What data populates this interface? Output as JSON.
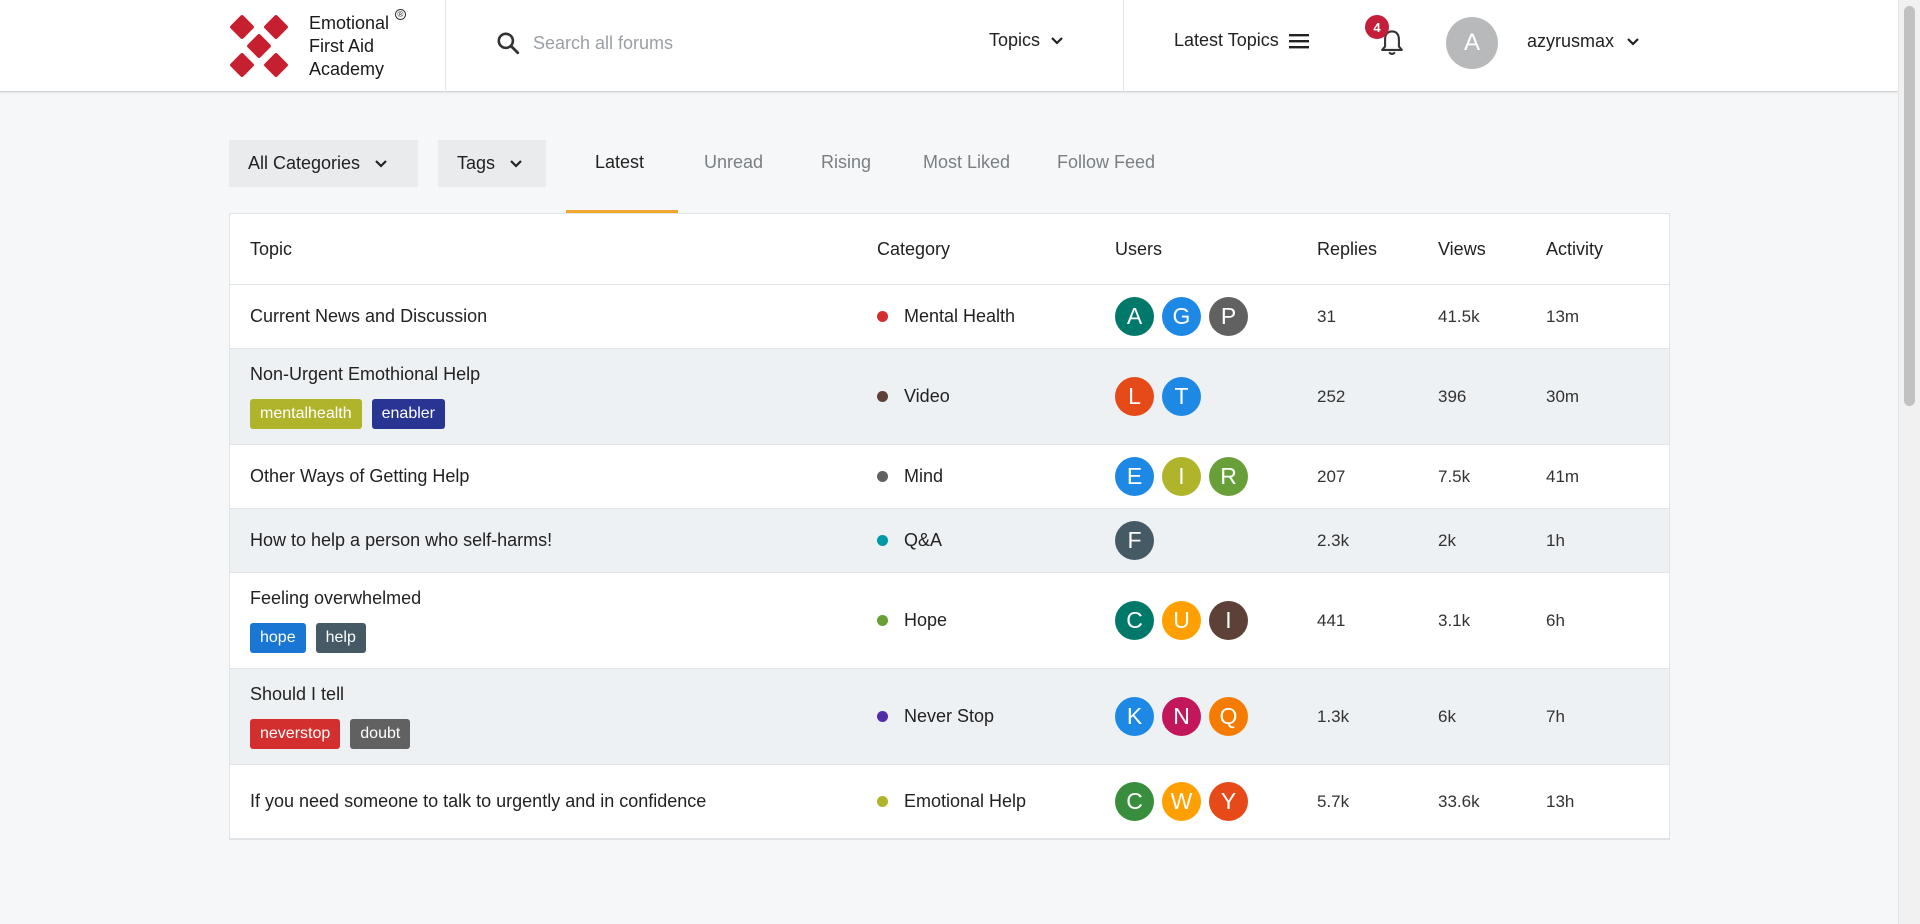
{
  "brand": {
    "line1": "Emotional",
    "line2": "First Aid",
    "line3": "Academy",
    "registered": "®"
  },
  "search": {
    "placeholder": "Search all forums"
  },
  "header_nav": {
    "topics": "Topics",
    "latest_topics": "Latest Topics"
  },
  "notifications": {
    "count": "4"
  },
  "user": {
    "avatar_letter": "A",
    "name": "azyrusmax"
  },
  "filters": {
    "categories": "All Categories",
    "tags": "Tags"
  },
  "tabs": [
    "Latest",
    "Unread",
    "Rising",
    "Most Liked",
    "Follow Feed"
  ],
  "columns": {
    "topic": "Topic",
    "category": "Category",
    "users": "Users",
    "replies": "Replies",
    "views": "Views",
    "activity": "Activity"
  },
  "topics": [
    {
      "title": "Current News and Discussion",
      "tags": [],
      "category": "Mental Health",
      "cat_color": "#d32f2f",
      "users": [
        {
          "l": "A",
          "c": "#00796b"
        },
        {
          "l": "G",
          "c": "#1e88e5"
        },
        {
          "l": "P",
          "c": "#616161"
        }
      ],
      "replies": "31",
      "views": "41.5k",
      "activity": "13m"
    },
    {
      "title": "Non-Urgent Emothional Help",
      "tags": [
        {
          "t": "mentalhealth",
          "c": "#afb42b"
        },
        {
          "t": "enabler",
          "c": "#283593"
        }
      ],
      "category": "Video",
      "cat_color": "#5d4037",
      "users": [
        {
          "l": "L",
          "c": "#e64a19"
        },
        {
          "l": "T",
          "c": "#1e88e5"
        }
      ],
      "replies": "252",
      "views": "396",
      "activity": "30m"
    },
    {
      "title": "Other Ways of Getting Help",
      "tags": [],
      "category": "Mind",
      "cat_color": "#616161",
      "users": [
        {
          "l": "E",
          "c": "#1e88e5"
        },
        {
          "l": "I",
          "c": "#afb42b"
        },
        {
          "l": "R",
          "c": "#689f38"
        }
      ],
      "replies": "207",
      "views": "7.5k",
      "activity": "41m"
    },
    {
      "title": "How to help a person who self-harms!",
      "tags": [],
      "category": "Q&A",
      "cat_color": "#0097a7",
      "users": [
        {
          "l": "F",
          "c": "#455a64"
        }
      ],
      "replies": "2.3k",
      "views": "2k",
      "activity": "1h"
    },
    {
      "title": "Feeling overwhelmed",
      "tags": [
        {
          "t": "hope",
          "c": "#1976d2"
        },
        {
          "t": "help",
          "c": "#455a64"
        }
      ],
      "category": "Hope",
      "cat_color": "#689f38",
      "users": [
        {
          "l": "C",
          "c": "#00796b"
        },
        {
          "l": "U",
          "c": "#ffa000"
        },
        {
          "l": "I",
          "c": "#5d4037"
        }
      ],
      "replies": "441",
      "views": "3.1k",
      "activity": "6h"
    },
    {
      "title": "Should I tell",
      "tags": [
        {
          "t": "neverstop",
          "c": "#d32f2f"
        },
        {
          "t": "doubt",
          "c": "#616161"
        }
      ],
      "category": "Never Stop",
      "cat_color": "#512da8",
      "users": [
        {
          "l": "K",
          "c": "#1e88e5"
        },
        {
          "l": "N",
          "c": "#c2185b"
        },
        {
          "l": "Q",
          "c": "#f57c00"
        }
      ],
      "replies": "1.3k",
      "views": "6k",
      "activity": "7h"
    },
    {
      "title": "If you need someone to talk to urgently and in confidence",
      "tags": [],
      "category": "Emotional Help",
      "cat_color": "#afb42b",
      "users": [
        {
          "l": "C",
          "c": "#388e3c"
        },
        {
          "l": "W",
          "c": "#ffa000"
        },
        {
          "l": "Y",
          "c": "#e64a19"
        }
      ],
      "replies": "5.7k",
      "views": "33.6k",
      "activity": "13h"
    }
  ]
}
